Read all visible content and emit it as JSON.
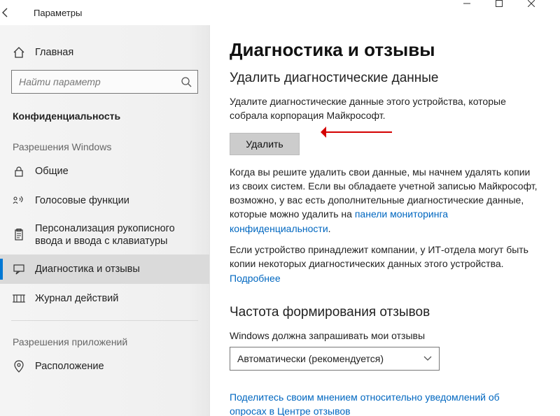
{
  "window": {
    "title": "Параметры"
  },
  "sidebar": {
    "home": "Главная",
    "search_placeholder": "Найти параметр",
    "current_section": "Конфиденциальность",
    "group_permissions_windows": "Разрешения Windows",
    "items": [
      {
        "label": "Общие"
      },
      {
        "label": "Голосовые функции"
      },
      {
        "label": "Персонализация рукописного ввода и ввода с клавиатуры"
      },
      {
        "label": "Диагностика и отзывы"
      },
      {
        "label": "Журнал действий"
      }
    ],
    "group_permissions_apps": "Разрешения приложений",
    "items_apps": [
      {
        "label": "Расположение"
      }
    ]
  },
  "main": {
    "page_title": "Диагностика и отзывы",
    "subheading": "Удалить диагностические данные",
    "intro": "Удалите диагностические данные этого устройства, которые собрала корпорация Майкрософт.",
    "delete_button": "Удалить",
    "after_delete_pre": "Когда вы решите удалить свои данные, мы начнем удалять копии из своих систем. Если вы обладаете учетной записью Майкрософт, возможно, у вас есть дополнительные диагностические данные, которые можно удалить на ",
    "privacy_dashboard_link": "панели мониторинга конфиденциальности",
    "after_delete_post": ".",
    "company_note": "Если устройство принадлежит компании, у ИТ-отдела могут быть копии некоторых диагностических данных этого устройства.",
    "learn_more": "Подробнее",
    "feedback_heading": "Частота формирования отзывов",
    "feedback_label": "Windows должна запрашивать мои отзывы",
    "feedback_value": "Автоматически (рекомендуется)",
    "share_opinion_link": "Поделитесь своим мнением относительно уведомлений об опросах в Центре отзывов"
  }
}
